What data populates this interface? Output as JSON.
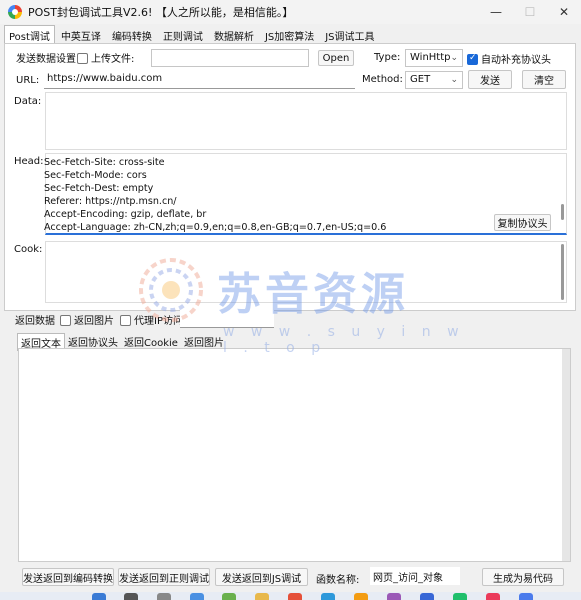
{
  "window": {
    "title": "POST封包调试工具V2.6!  【人之所以能，是相信能。】",
    "minimize": "—",
    "maximize": "☐",
    "close": "✕"
  },
  "tabs": [
    "Post调试",
    "中英互译",
    "编码转换",
    "正则调试",
    "数据解析",
    "JS加密算法",
    "JS调试工具"
  ],
  "post": {
    "send_settings_label": "发送数据设置",
    "upload_file_label": "上传文件:",
    "upload_file_value": "",
    "open_button": "Open",
    "type_label": "Type:",
    "type_value": "WinHttp",
    "auto_header_label": "自动补充协议头",
    "url_label": "URL:",
    "url_value": "https://www.baidu.com",
    "method_label": "Method:",
    "method_value": "GET",
    "send_button": "发送",
    "clear_button": "清空",
    "data_label": "Data:",
    "head_label": "Head:",
    "head_lines": [
      "Sec-Fetch-Site: cross-site",
      "Sec-Fetch-Mode: cors",
      "Sec-Fetch-Dest: empty",
      "Referer: https://ntp.msn.cn/",
      "Accept-Encoding: gzip, deflate, br",
      "Accept-Language: zh-CN,zh;q=0.9,en;q=0.8,en-GB;q=0.7,en-US;q=0.6"
    ],
    "copy_header_button": "复制协议头",
    "cook_label": "Cook:"
  },
  "response": {
    "return_data_label": "返回数据",
    "return_image_label": "返回图片",
    "proxy_label": "代理IP访问:",
    "proxy_value": "",
    "subtabs": [
      "返回文本",
      "返回协议头",
      "返回Cookie",
      "返回图片"
    ]
  },
  "bottom": {
    "send_to_encode": "发送返回到编码转换",
    "send_to_regex": "发送返回到正则调试",
    "send_to_js": "发送返回到JS调试",
    "func_name_label": "函数名称:",
    "func_name_value": "网页_访问_对象",
    "gen_code_button": "生成为易代码"
  },
  "watermark": {
    "text": "苏音资源",
    "url": "w w w . s u y i n w l . t o p"
  }
}
